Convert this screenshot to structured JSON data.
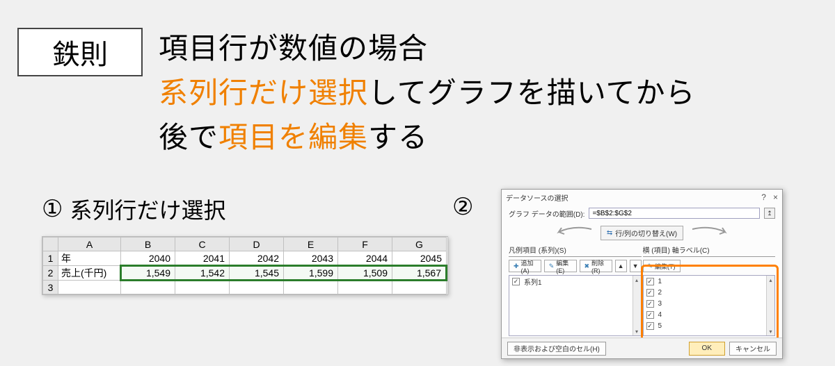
{
  "badge": "鉄則",
  "big_text": {
    "line1": "項目行が数値の場合",
    "line2a": "系列行だけ選択",
    "line2b": "してグラフを描いてから",
    "line3a": "後で",
    "line3b": "項目を編集",
    "line3c": "する"
  },
  "step1": {
    "num": "①",
    "label": "系列行だけ選択"
  },
  "step2": {
    "num": "②"
  },
  "sheet": {
    "cols": [
      "A",
      "B",
      "C",
      "D",
      "E",
      "F",
      "G"
    ],
    "rows": [
      "1",
      "2",
      "3"
    ],
    "r1a": "年",
    "years": [
      "2040",
      "2041",
      "2042",
      "2043",
      "2044",
      "2045"
    ],
    "r2a": "売上(千円)",
    "sales": [
      "1,549",
      "1,542",
      "1,545",
      "1,599",
      "1,509",
      "1,567"
    ]
  },
  "dialog": {
    "title": "データソースの選択",
    "help": "?",
    "close": "×",
    "range_label": "グラフ データの範囲(D):",
    "range_value": "=$B$2:$G$2",
    "swap_btn": "行/列の切り替え(W)",
    "left_header": "凡例項目 (系列)(S)",
    "right_header": "横 (項目) 軸ラベル(C)",
    "btns": {
      "add": "追加(A)",
      "edit": "編集(E)",
      "del": "削除(R)",
      "editT": "編集(T)"
    },
    "left_items": [
      {
        "checked": true,
        "label": "系列1"
      }
    ],
    "right_items": [
      {
        "checked": true,
        "label": "1"
      },
      {
        "checked": true,
        "label": "2"
      },
      {
        "checked": true,
        "label": "3"
      },
      {
        "checked": true,
        "label": "4"
      },
      {
        "checked": true,
        "label": "5"
      }
    ],
    "hidden_btn": "非表示および空白のセル(H)",
    "ok": "OK",
    "cancel": "キャンセル"
  },
  "chart_data": {
    "type": "table",
    "title": "売上(千円) by 年",
    "categories": [
      2040,
      2041,
      2042,
      2043,
      2044,
      2045
    ],
    "series": [
      {
        "name": "売上(千円)",
        "values": [
          1549,
          1542,
          1545,
          1599,
          1509,
          1567
        ]
      }
    ],
    "xlabel": "年",
    "ylabel": "売上(千円)"
  }
}
